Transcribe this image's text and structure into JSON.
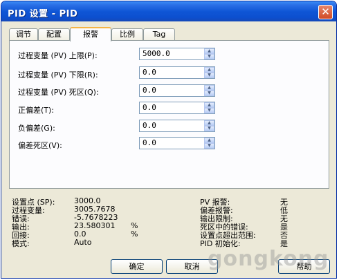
{
  "window": {
    "title": "PID 设置 - PID"
  },
  "tabs": [
    "调节",
    "配置",
    "报警",
    "比例",
    "Tag"
  ],
  "active_tab": "报警",
  "fields": [
    {
      "label": "过程变量 (PV) 上限(P):",
      "value": "5000.0"
    },
    {
      "label": "过程变量 (PV) 下限(R):",
      "value": "0.0"
    },
    {
      "label": "过程变量 (PV) 死区(Q):",
      "value": "0.0"
    },
    {
      "label": "正偏差(T):",
      "value": "0.0"
    },
    {
      "label": "负偏差(G):",
      "value": "0.0"
    },
    {
      "label": "偏差死区(V):",
      "value": "0.0"
    }
  ],
  "status_left": [
    {
      "label": "设置点 (SP):",
      "value": "3000.0",
      "unit": ""
    },
    {
      "label": "过程变量:",
      "value": "3005.7678",
      "unit": ""
    },
    {
      "label": "错误:",
      "value": "-5.7678223",
      "unit": ""
    },
    {
      "label": "输出:",
      "value": "23.580301",
      "unit": "%"
    },
    {
      "label": "回接:",
      "value": "0.0",
      "unit": "%"
    },
    {
      "label": "模式:",
      "value": "Auto",
      "unit": ""
    }
  ],
  "status_right": [
    {
      "label": "PV 报警:",
      "value": "无"
    },
    {
      "label": "偏差报警:",
      "value": "低"
    },
    {
      "label": "输出限制:",
      "value": "无"
    },
    {
      "label": "死区中的错误:",
      "value": "是"
    },
    {
      "label": "设置点超出范围:",
      "value": "否"
    },
    {
      "label": "PID 初始化:",
      "value": "是"
    }
  ],
  "buttons": {
    "ok": "确定",
    "cancel": "取消",
    "help": "帮助"
  },
  "watermark": "gongkong",
  "colors": {
    "titlebar": "#0c4fcf",
    "dialog_bg": "#ece9d8",
    "active_tab_accent": "#f5b444"
  }
}
